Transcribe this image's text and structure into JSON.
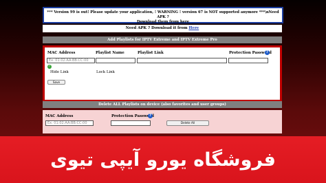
{
  "notice": {
    "line1": "*** Version 99 is out! Please update your application, ! WARNING ! version 67 is NOT supported anymore ***\\nNeed APK ?",
    "line2": "Download them from here"
  },
  "apk": {
    "text": "Need APK ? Download it from",
    "link": "Here"
  },
  "add_bar": "Add Playlists for IPTV Extreme and IPTV Extreme Pro",
  "add_form": {
    "mac_label": "MAC Address",
    "playlist_name_label": "Playlist Name",
    "playlist_link_label": "Playlist Link",
    "protection_label": "Protection Password",
    "mac_placeholder": "Ex. 01:02:AA:BB:CC:00",
    "hide_link": "Hide Link",
    "lock_link": "Lock Link",
    "save": "Save",
    "help_glyph": "?",
    "check_glyph": "✓"
  },
  "delete_bar": "Delete ALL Playlists on device (also favorites and user groups)",
  "delete_form": {
    "mac_label": "MAC Address",
    "protection_label": "Protection Password",
    "mac_placeholder": "Ex. 01:02:AA:BB:CC:00",
    "delete_all": "Delete All",
    "help_glyph": "?"
  },
  "banner": {
    "text": "فروشگاه یورو آیپی تیوی"
  },
  "colors": {
    "accent_red": "#e51d24",
    "border_blue": "#1d3fa0",
    "form_border": "#c00000"
  }
}
